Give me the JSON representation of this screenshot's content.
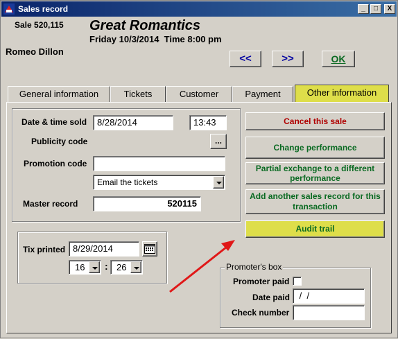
{
  "window": {
    "title": "Sales record",
    "min_glyph": "_",
    "max_glyph": "□",
    "close_glyph": "X"
  },
  "header": {
    "sale_label": "Sale 520,115",
    "event_title": "Great Romantics",
    "event_datetime": "Friday 10/3/2014  Time 8:00 pm",
    "customer_name": "Romeo Dillon"
  },
  "nav": {
    "prev_label": "<<",
    "next_label": ">>",
    "ok_label": "OK"
  },
  "tabs": [
    {
      "label": "General information"
    },
    {
      "label": "Tickets"
    },
    {
      "label": "Customer"
    },
    {
      "label": "Payment"
    },
    {
      "label": "Other information",
      "active": true
    }
  ],
  "form": {
    "date_time_sold_label": "Date & time sold",
    "date_sold_value": "8/28/2014",
    "time_sold_value": "13:43",
    "publicity_code_label": "Publicity code",
    "publicity_button_label": "...",
    "promotion_code_label": "Promotion code",
    "promotion_code_value": "",
    "delivery_select_value": "Email the tickets",
    "master_record_label": "Master record",
    "master_record_value": "520115"
  },
  "tix": {
    "label": "Tix printed",
    "date_value": "8/29/2014",
    "hour_value": "16",
    "separator": ":",
    "minute_value": "26"
  },
  "actions": {
    "cancel_label": "Cancel this sale",
    "change_performance_label": "Change performance",
    "partial_exchange_label": "Partial exchange to a different performance",
    "add_another_label": "Add another sales record for this transaction",
    "audit_trail_label": "Audit trail"
  },
  "promoter": {
    "box_label": "Promoter's box",
    "paid_label": "Promoter paid",
    "date_paid_label": "Date paid",
    "date_paid_value": " /  /",
    "check_number_label": "Check number",
    "check_number_value": ""
  },
  "colors": {
    "title_bar": "#0a246a",
    "active_tab": "#dede4a",
    "green_text": "#0a6a22",
    "red_text": "#b00000",
    "nav_text": "#0000a0",
    "arrow": "#e01818"
  }
}
